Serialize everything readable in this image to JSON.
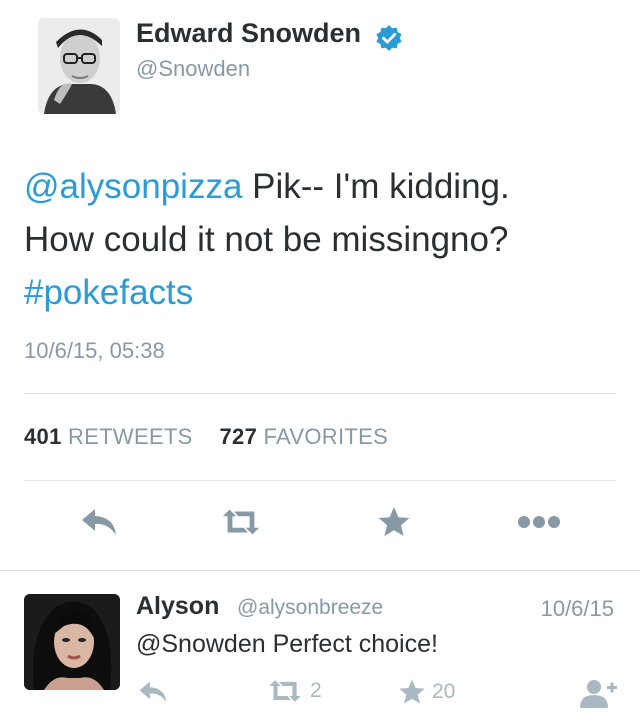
{
  "author": {
    "name": "Edward Snowden",
    "handle": "@Snowden",
    "verified": true
  },
  "tweet": {
    "mention": "@alysonpizza",
    "text_line1": " Pik-- I'm kidding.",
    "text_line2": "How could it not be missingno?",
    "hashtag": "#pokefacts",
    "timestamp": "10/6/15, 05:38"
  },
  "stats": {
    "retweets_count": "401",
    "retweets_label": "RETWEETS",
    "favorites_count": "727",
    "favorites_label": "FAVORITES"
  },
  "actions": [
    {
      "icon": "reply-icon"
    },
    {
      "icon": "retweet-icon"
    },
    {
      "icon": "favorite-star-icon"
    },
    {
      "icon": "more-dots-icon"
    }
  ],
  "reply": {
    "name": "Alyson",
    "handle": "@alysonbreeze",
    "date": "10/6/15",
    "text": "@Snowden Perfect choice!",
    "retweet_count": "2",
    "favorite_count": "20"
  },
  "colors": {
    "link": "#2b9bd8",
    "verified": "#2b9bd8",
    "muted": "#8899a6",
    "icon": "#8899a6",
    "icon_light": "#aab8c2",
    "text": "#292f33"
  }
}
